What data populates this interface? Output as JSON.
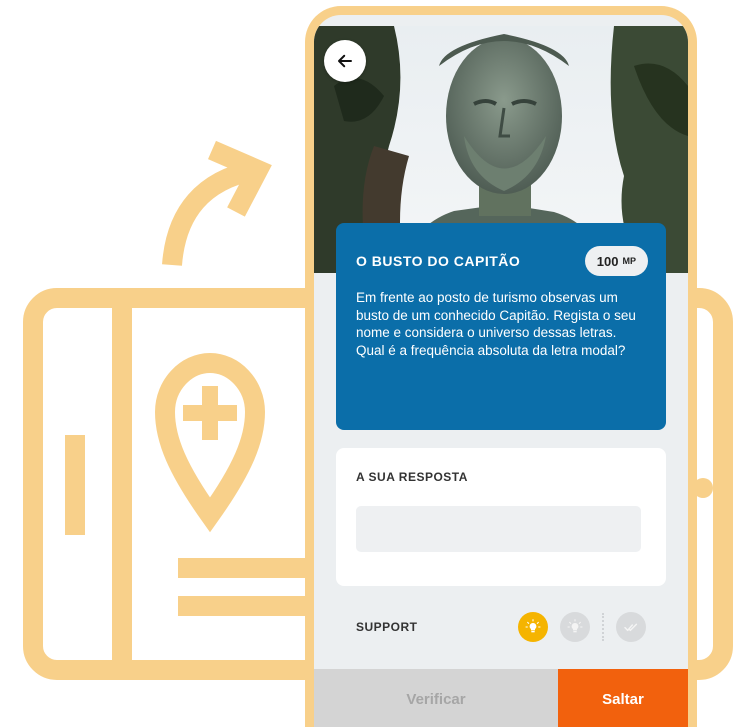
{
  "colors": {
    "accent_blue": "#0b6ea9",
    "accent_orange": "#f2610d",
    "illustration_peach": "#f8d08a",
    "hint_yellow": "#f5b400"
  },
  "header": {
    "back_icon": "arrow-left-icon"
  },
  "question": {
    "title": "O BUSTO DO CAPITÃO",
    "points_value": "100",
    "points_unit": "MP",
    "text_line1": "Em frente ao posto de turismo observas um busto de um conhecido Capitão. Regista o seu nome e considera o universo dessas letras.",
    "text_line2": "Qual é a frequência absoluta da letra modal?"
  },
  "answer": {
    "label": "A SUA RESPOSTA",
    "value": "",
    "placeholder": ""
  },
  "support": {
    "label": "SUPPORT",
    "hints": [
      {
        "icon": "lightbulb-icon",
        "state": "active"
      },
      {
        "icon": "lightbulb-icon",
        "state": "inactive"
      },
      {
        "icon": "double-check-icon",
        "state": "inactive"
      }
    ]
  },
  "actions": {
    "verify_label": "Verificar",
    "skip_label": "Saltar"
  }
}
